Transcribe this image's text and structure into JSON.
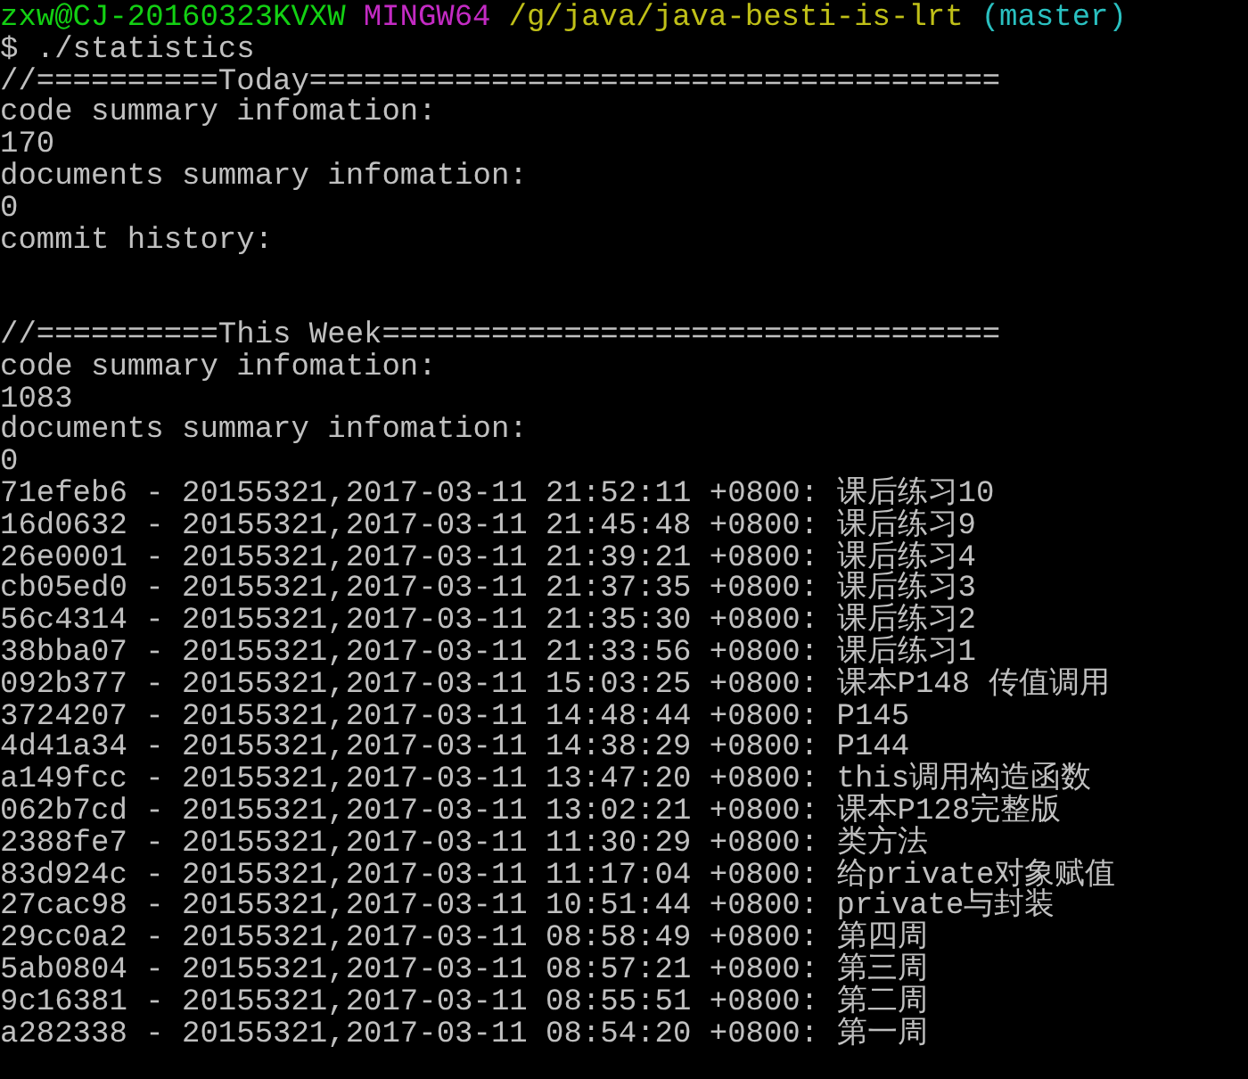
{
  "prompt": {
    "user_host": "zxw@CJ-20160323KVXW",
    "system": "MINGW64",
    "path": "/g/java/java-besti-is-lrt",
    "branch": "(master)"
  },
  "command": "$ ./statistics",
  "output": [
    "//==========Today======================================",
    "code summary infomation:",
    "170",
    "documents summary infomation:",
    "0",
    "commit history:"
  ],
  "output_week": [
    "//==========This Week==================================",
    "code summary infomation:",
    "1083",
    "documents summary infomation:",
    "0",
    "71efeb6 - 20155321,2017-03-11 21:52:11 +0800: 课后练习10",
    "16d0632 - 20155321,2017-03-11 21:45:48 +0800: 课后练习9",
    "26e0001 - 20155321,2017-03-11 21:39:21 +0800: 课后练习4",
    "cb05ed0 - 20155321,2017-03-11 21:37:35 +0800: 课后练习3",
    "56c4314 - 20155321,2017-03-11 21:35:30 +0800: 课后练习2",
    "38bba07 - 20155321,2017-03-11 21:33:56 +0800: 课后练习1",
    "092b377 - 20155321,2017-03-11 15:03:25 +0800: 课本P148 传值调用",
    "3724207 - 20155321,2017-03-11 14:48:44 +0800: P145",
    "4d41a34 - 20155321,2017-03-11 14:38:29 +0800: P144",
    "a149fcc - 20155321,2017-03-11 13:47:20 +0800: this调用构造函数",
    "062b7cd - 20155321,2017-03-11 13:02:21 +0800: 课本P128完整版",
    "2388fe7 - 20155321,2017-03-11 11:30:29 +0800: 类方法",
    "83d924c - 20155321,2017-03-11 11:17:04 +0800: 给private对象赋值",
    "27cac98 - 20155321,2017-03-11 10:51:44 +0800: private与封装",
    "29cc0a2 - 20155321,2017-03-11 08:58:49 +0800: 第四周",
    "5ab0804 - 20155321,2017-03-11 08:57:21 +0800: 第三周",
    "9c16381 - 20155321,2017-03-11 08:55:51 +0800: 第二周",
    "a282338 - 20155321,2017-03-11 08:54:20 +0800: 第一周"
  ]
}
